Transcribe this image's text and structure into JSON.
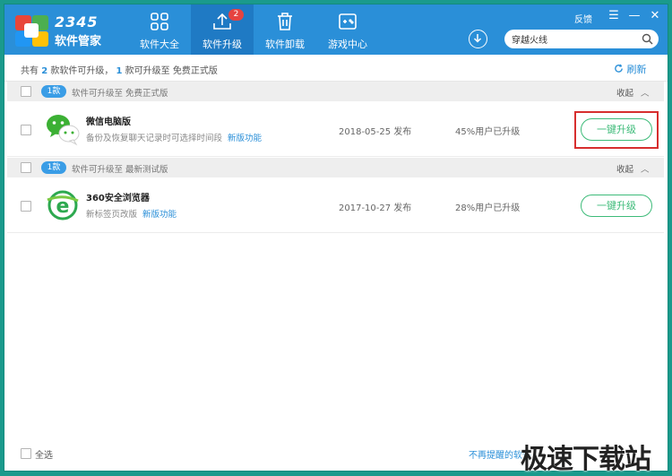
{
  "app": {
    "brand_number": "2345",
    "brand_name": "软件管家"
  },
  "nav": {
    "tabs": [
      {
        "label": "软件大全",
        "icon": "apps-grid-icon"
      },
      {
        "label": "软件升级",
        "icon": "upload-arrow-icon",
        "badge": "2",
        "active": true
      },
      {
        "label": "软件卸载",
        "icon": "trash-icon"
      },
      {
        "label": "游戏中心",
        "icon": "gamepad-icon"
      }
    ]
  },
  "window_controls": {
    "feedback": "反馈",
    "menu": "☰",
    "minimize": "—",
    "close": "✕"
  },
  "search": {
    "value": "穿越火线"
  },
  "summary": {
    "prefix": "共有 ",
    "total": "2",
    "mid1": " 款软件可升级， ",
    "free_count": "1",
    "mid2": " 款可升级至 免费正式版",
    "refresh": "刷新"
  },
  "groups": [
    {
      "badge": "1款",
      "text": "软件可升级至  免费正式版",
      "collapse": "收起",
      "items": [
        {
          "name": "微信电脑版",
          "desc": "备份及恢复聊天记录时可选择时间段",
          "new_feature": "新版功能",
          "date": "2018-05-25 发布",
          "percent": "45%用户已升级",
          "button": "一键升级",
          "highlighted": true
        }
      ]
    },
    {
      "badge": "1款",
      "text": "软件可升级至  最新测试版",
      "collapse": "收起",
      "items": [
        {
          "name": "360安全浏览器",
          "desc": "新标签页改版",
          "new_feature": "新版功能",
          "date": "2017-10-27 发布",
          "percent": "28%用户已升级",
          "button": "一键升级",
          "highlighted": false
        }
      ]
    }
  ],
  "footer": {
    "select_all": "全选",
    "no_remind": "不再提醒的软件",
    "watermark": "极速下载站"
  },
  "colors": {
    "titlebar": "#2a8fd8",
    "active_tab": "#1f7ac4",
    "upgrade_green": "#3dbb79",
    "highlight_red": "#d72e2e",
    "link_blue": "#2a8fd8"
  }
}
